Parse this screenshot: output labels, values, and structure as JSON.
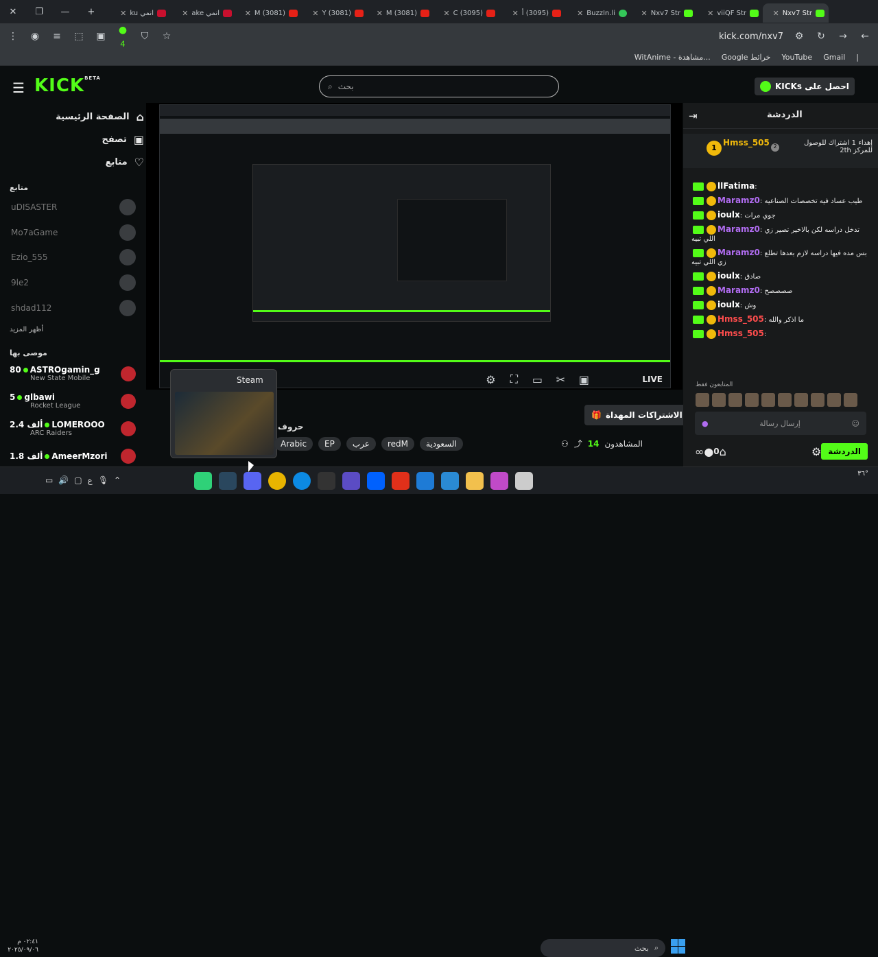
{
  "browser": {
    "tabs": [
      {
        "label": "انمي ku",
        "icon": "top",
        "active": false
      },
      {
        "label": "انمي ake",
        "icon": "top",
        "active": false
      },
      {
        "label": "(3081) M",
        "icon": "yt",
        "active": false
      },
      {
        "label": "(3081) Y",
        "icon": "yt",
        "active": false
      },
      {
        "label": "(3081) M",
        "icon": "yt",
        "active": false
      },
      {
        "label": "(3095) C",
        "icon": "yt",
        "active": false
      },
      {
        "label": "(3095) أ",
        "icon": "yt",
        "active": false
      },
      {
        "label": "BuzzIn.li",
        "icon": "gr",
        "active": false
      },
      {
        "label": "Nxv7 Str",
        "icon": "kk",
        "active": false
      },
      {
        "label": "viiQF Str",
        "icon": "kk",
        "active": false
      },
      {
        "label": "Nxv7 Str",
        "icon": "kk",
        "active": true
      }
    ],
    "url": "kick.com/nxv7",
    "extension_badge": "4",
    "bookmarks": [
      "WitAnime - مشاهدة...",
      "Google خرائط",
      "YouTube",
      "Gmail"
    ]
  },
  "kick": {
    "search_placeholder": "بحث",
    "get_kicks": "احصل على KICKs",
    "logo": "KICK",
    "logo_sup": "BETA",
    "nav": [
      {
        "label": "الصفحة الرئيسية",
        "icon": "home-icon"
      },
      {
        "label": "تصفح",
        "icon": "browse-icon"
      },
      {
        "label": "متابع",
        "icon": "heart-icon"
      }
    ],
    "following_title": "متابع",
    "following": [
      "uDISASTER",
      "Mo7aGame",
      "Ezio_555",
      "9le2",
      "shdad112"
    ],
    "show_more": "أظهر المزيد",
    "recommended_title": "موصى بها",
    "recommended": [
      {
        "count": "80",
        "name": "ASTROgamin_g",
        "game": "New State Mobile"
      },
      {
        "count": "5",
        "name": "glbawi",
        "game": "Rocket League"
      },
      {
        "count": "2.4 ألف",
        "name": "LOMEROOO",
        "game": "ARC Raiders"
      },
      {
        "count": "1.8 ألف",
        "name": "AmeerMzori",
        "game": ""
      }
    ],
    "player": {
      "steam_label": "Steam",
      "live": "LIVE"
    },
    "stream": {
      "title_fragment": "حروف",
      "tags": [
        "Arabic",
        "EP",
        "عرب",
        "redM",
        "السعودية"
      ],
      "subs_button": "الاشتراكات المهداة",
      "viewers_label": "المشاهدون",
      "viewers": "14"
    },
    "chat": {
      "title": "الدردشة",
      "pinned_user": "Hmss_505",
      "pinned_count": "1",
      "pinned_rank": "2",
      "pinned_text": "إهداء 1 اشتراك للوصول للمركز 2th",
      "messages": [
        {
          "user": "llFatima",
          "color": "#ffffff",
          "text": ""
        },
        {
          "user": "Maramz0",
          "color": "#b06cf0",
          "text": "طيب عساد فيه تخصصات الصناعيه"
        },
        {
          "user": "ioulx",
          "color": "#ffffff",
          "text": "جوي مرات"
        },
        {
          "user": "Maramz0",
          "color": "#b06cf0",
          "text": "تدخل دراسه لكن بالاخير تصير زي اللي تبيه"
        },
        {
          "user": "Maramz0",
          "color": "#b06cf0",
          "text": "بس مده فيها دراسه لازم بعدها تطلع زي اللي تبيه"
        },
        {
          "user": "ioulx",
          "color": "#ffffff",
          "text": "صادق"
        },
        {
          "user": "Maramz0",
          "color": "#b06cf0",
          "text": "صصصصح"
        },
        {
          "user": "ioulx",
          "color": "#ffffff",
          "text": "وش"
        },
        {
          "user": "Hmss_505",
          "color": "#ff4d4d",
          "text": "ما اذكر والله"
        },
        {
          "user": "Hmss_505",
          "color": "#ff4d4d",
          "text": ""
        }
      ],
      "emote_label": "المتابعون فقط",
      "input_placeholder": "إرسال رسالة",
      "points": "0",
      "send": "الدردشة"
    }
  },
  "taskbar": {
    "search": "بحث",
    "time": "٠٢:٤١ م",
    "date": "٢٠٢٥/٠٩/٠٦",
    "temp": "٣٦°"
  }
}
